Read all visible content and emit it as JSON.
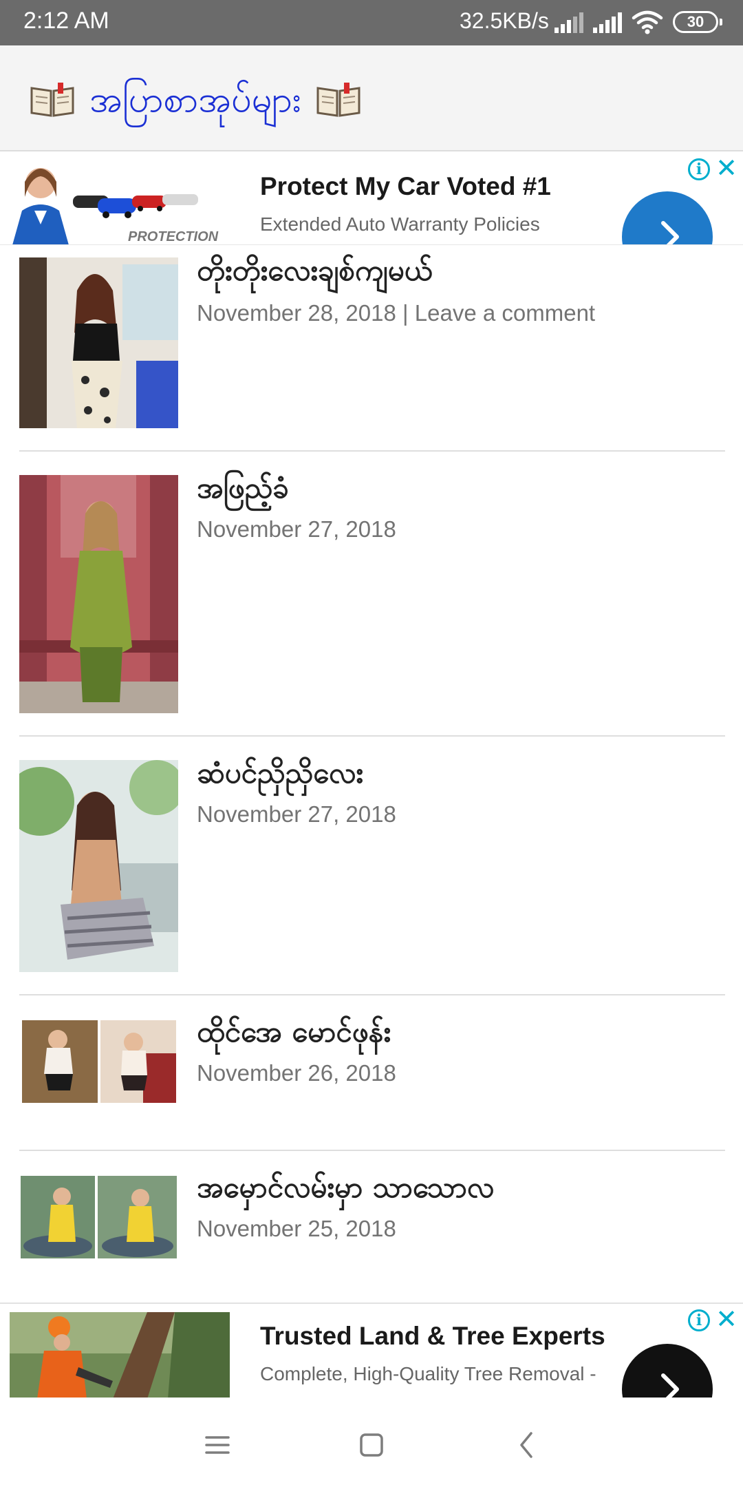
{
  "status_bar": {
    "time": "2:12 AM",
    "network_speed": "32.5KB/s",
    "battery_level": "30"
  },
  "site": {
    "title": "အပြာစာအုပ်များ",
    "title_color": "#1a2fd4",
    "left_icon": "open-book-icon",
    "right_icon": "open-book-icon"
  },
  "ads": {
    "top": {
      "title": "Protect My Car Voted #1",
      "subtitle": "Extended Auto Warranty Policies",
      "image_caption": "PROTECTION",
      "button_color": "#1f7ac9",
      "info_icon": "info-icon",
      "close_icon": "close-icon"
    },
    "bottom": {
      "title": "Trusted Land & Tree Experts",
      "subtitle": "Complete, High-Quality Tree Removal -",
      "button_color": "#111111",
      "info_icon": "info-icon",
      "close_icon": "close-icon"
    }
  },
  "posts": [
    {
      "title": "တိုးတိုးလေးချစ်ကျမယ်",
      "date": "November 28, 2018",
      "meta_suffix": " | ",
      "comment_link": "Leave a comment"
    },
    {
      "title": "အဖြည့်ခံ",
      "date": "November 27, 2018"
    },
    {
      "title": "ဆံပင်ညှိညှိလေး",
      "date": "November 27, 2018"
    },
    {
      "title": "ထိုင်အေ မောင်ဖုန်း",
      "date": "November 26, 2018"
    },
    {
      "title": "အမှောင်လမ်းမှာ သာသောလ",
      "date": "November 25, 2018"
    }
  ],
  "nav_bar": {
    "menu_icon": "menu-icon",
    "home_icon": "home-square-icon",
    "back_icon": "back-chevron-icon"
  }
}
